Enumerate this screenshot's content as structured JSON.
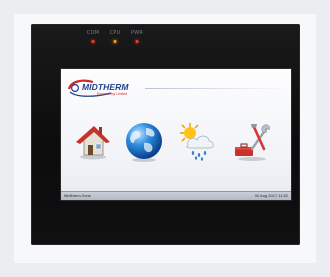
{
  "indicators": [
    {
      "label": "COM",
      "state": "on",
      "color": "#ff3a1f"
    },
    {
      "label": "CPU",
      "state": "on",
      "color": "#ff9a1f"
    },
    {
      "label": "PWR",
      "state": "on",
      "color": "#ff3a1f"
    }
  ],
  "screen": {
    "logo": {
      "name": "MIDTHERM",
      "tagline": "Engineering Limited"
    },
    "menu": [
      {
        "name": "home",
        "icon": "house-icon"
      },
      {
        "name": "globe",
        "icon": "globe-icon"
      },
      {
        "name": "weather",
        "icon": "weather-icon"
      },
      {
        "name": "tools",
        "icon": "tools-icon"
      }
    ],
    "status": {
      "left": "Midtherm Zone",
      "right": "00 Aug 2017 11:52"
    }
  },
  "colors": {
    "brand_blue": "#243f8c",
    "brand_red": "#d12a2a",
    "bezel": "#121213"
  }
}
